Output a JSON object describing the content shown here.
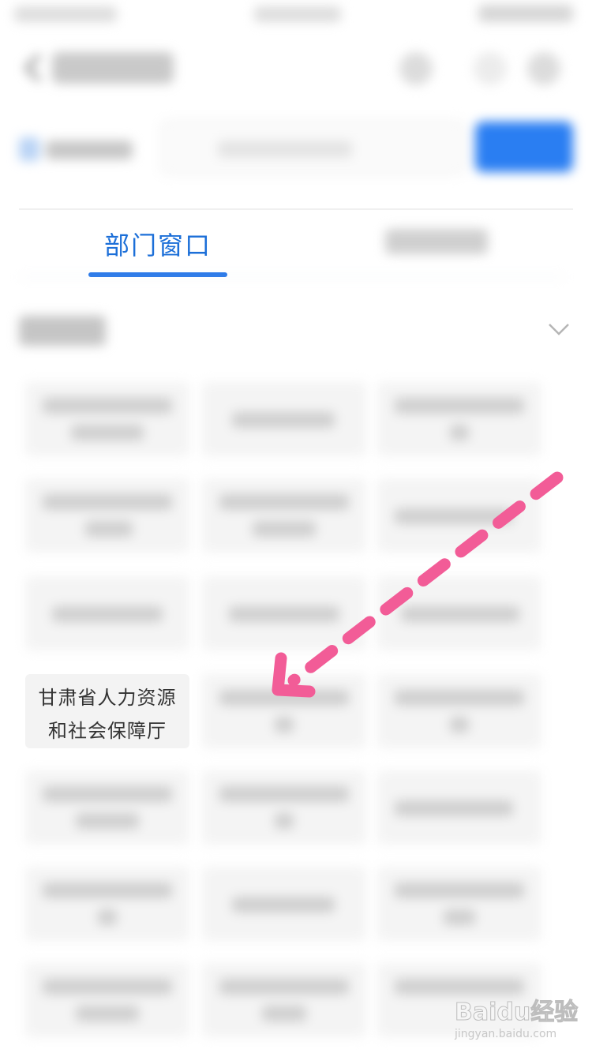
{
  "tabs": {
    "active_label": "部门窗口"
  },
  "departments": {
    "highlighted": {
      "line1": "甘肃省人力资源",
      "line2": "和社会保障厅"
    }
  },
  "colors": {
    "accent": "#1a6fe8",
    "search_button": "#2a7ef2",
    "arrow": "#f25c97"
  },
  "watermark": {
    "brand_text": "Baidu经验",
    "url_text": "jingyan.baidu.com"
  }
}
